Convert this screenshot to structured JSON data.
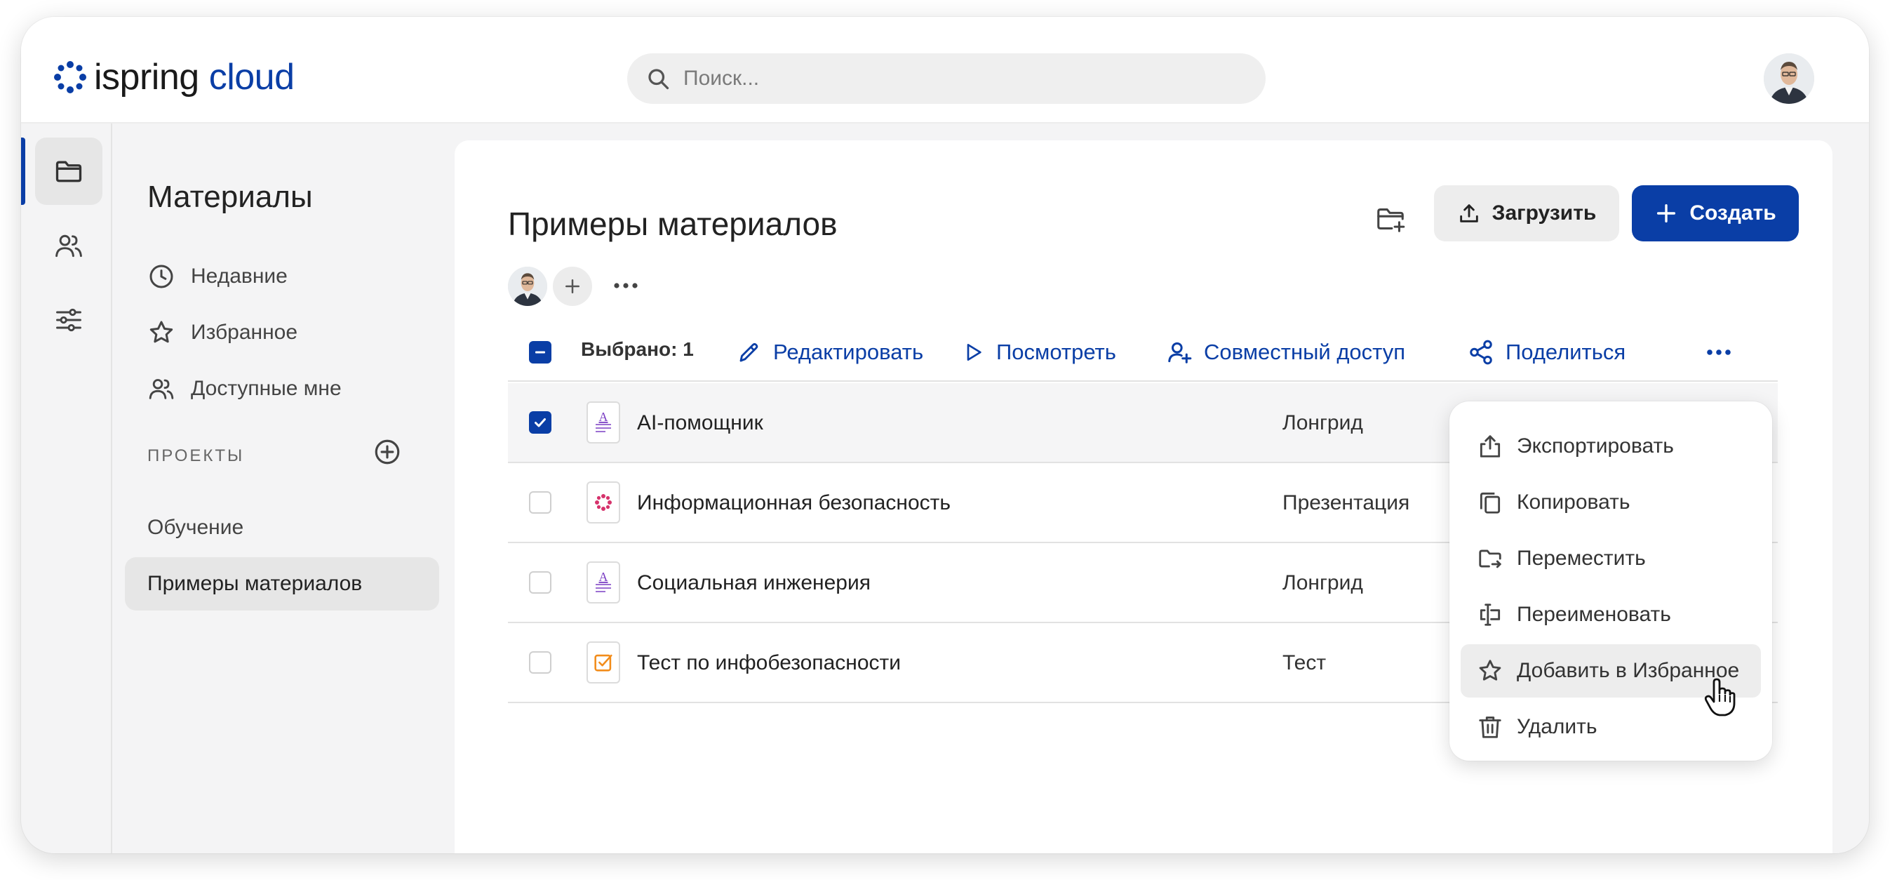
{
  "header": {
    "logo_part1": "ispring",
    "logo_part2": "cloud",
    "search_placeholder": "Поиск..."
  },
  "colors": {
    "accent": "#0a3ea6",
    "background": "#f4f4f5"
  },
  "rail": {
    "items": [
      {
        "icon": "folder-icon",
        "active": true
      },
      {
        "icon": "users-icon",
        "active": false
      },
      {
        "icon": "sliders-icon",
        "active": false
      }
    ]
  },
  "sidenav": {
    "title": "Материалы",
    "items": [
      {
        "label": "Недавние",
        "icon": "clock-icon"
      },
      {
        "label": "Избранное",
        "icon": "star-icon"
      },
      {
        "label": "Доступные мне",
        "icon": "users-icon"
      }
    ],
    "projects_header": "ПРОЕКТЫ",
    "projects": [
      {
        "label": "Обучение",
        "active": false
      },
      {
        "label": "Примеры материалов",
        "active": true
      }
    ]
  },
  "main": {
    "title": "Примеры материалов",
    "upload_label": "Загрузить",
    "create_label": "Создать",
    "selection": {
      "selected_label": "Выбрано: 1",
      "actions": [
        "Редактировать",
        "Посмотреть",
        "Совместный доступ",
        "Поделиться"
      ]
    },
    "rows": [
      {
        "name": "AI-помощник",
        "type": "Лонгрид",
        "icon": "longread-icon",
        "checked": true
      },
      {
        "name": "Информационная безопасность",
        "type": "Презентация",
        "icon": "presentation-icon",
        "checked": false
      },
      {
        "name": "Социальная инженерия",
        "type": "Лонгрид",
        "icon": "longread-icon",
        "checked": false
      },
      {
        "name": "Тест по инфобезопасности",
        "type": "Тест",
        "icon": "quiz-icon",
        "checked": false
      }
    ]
  },
  "context_menu": {
    "items": [
      {
        "label": "Экспортировать",
        "icon": "export-icon"
      },
      {
        "label": "Копировать",
        "icon": "copy-icon"
      },
      {
        "label": "Переместить",
        "icon": "move-icon"
      },
      {
        "label": "Переименовать",
        "icon": "rename-icon"
      },
      {
        "label": "Добавить в Избранное",
        "icon": "star-icon",
        "hovered": true
      },
      {
        "label": "Удалить",
        "icon": "trash-icon"
      }
    ]
  }
}
